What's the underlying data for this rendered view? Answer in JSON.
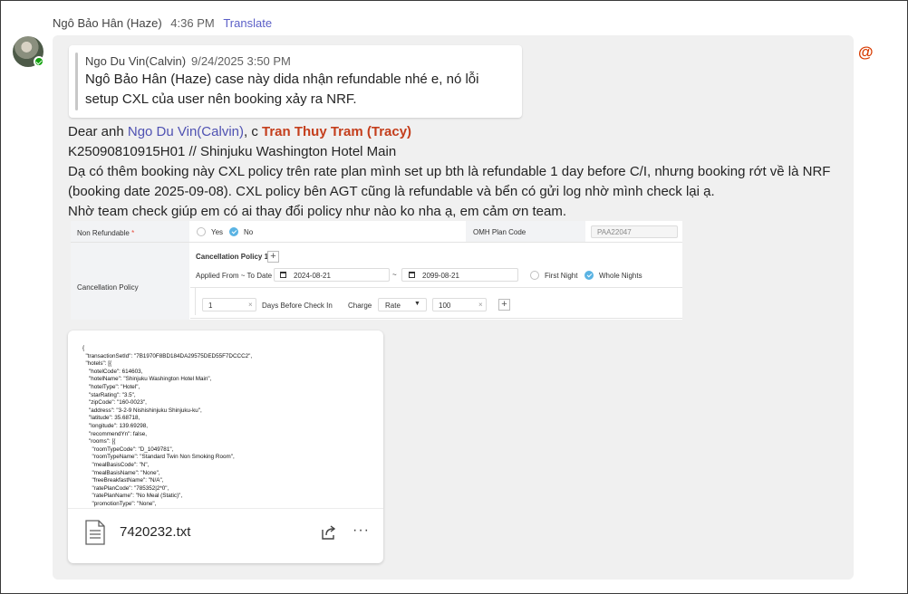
{
  "message": {
    "sender": "Ngô Bảo Hân (Haze)",
    "time": "4:36 PM",
    "translate": "Translate",
    "mention_symbol": "@"
  },
  "quote": {
    "author": "Ngo Du Vin(Calvin)",
    "time": "9/24/2025 3:50 PM",
    "text": "Ngô Bảo Hân (Haze) case này dida nhận refundable nhé e, nó lỗi setup CXL của user nên booking xảy ra NRF."
  },
  "body": {
    "greeting": "Dear anh ",
    "mention1": "Ngo Du Vin(Calvin)",
    "sep": ", c ",
    "mention2": "Tran Thuy Tram (Tracy)",
    "line2": "K25090810915H01 // Shinjuku Washington Hotel Main",
    "line3": "Dạ có thêm booking này CXL policy trên rate plan mình set up bth là refundable 1 day before C/I, nhưng booking rớt về là NRF (booking date 2025-09-08). CXL policy bên AGT cũng là refundable và bển có gửi log nhờ mình check lại ạ.",
    "line4": "Nhờ team check giúp em có ai thay đổi policy như nào ko nha ạ, em cảm ơn team."
  },
  "screenshot": {
    "non_refundable_label": "Non Refundable",
    "required_mark": "*",
    "yes": "Yes",
    "no": "No",
    "omh_label": "OMH Plan Code",
    "omh_value": "PAA22047",
    "cancellation_label": "Cancellation Policy",
    "policy_title": "Cancellation Policy 1",
    "applied_label": "Applied From ~ To Date",
    "date_from": "2024-08-21",
    "date_sep": "~",
    "date_to": "2099-08-21",
    "first_night": "First Night",
    "whole_nights": "Whole Nights",
    "days_value": "1",
    "days_label": "Days Before Check In",
    "charge_label": "Charge",
    "charge_type": "Rate",
    "charge_value": "100",
    "no_selected": true,
    "whole_nights_selected": true
  },
  "attachment": {
    "file_name": "7420232.txt",
    "preview": "{\n  \"transactionSetId\": \"7B1970F8BD184DA29575DED55F7DCCC2\",\n  \"hotels\": [{\n    \"hotelCode\": 614603,\n    \"hotelName\": \"Shinjuku Washington Hotel Main\",\n    \"hotelType\": \"Hotel\",\n    \"starRating\": \"3.5\",\n    \"zipCode\": \"160-0023\",\n    \"address\": \"3-2-9 Nishishinjuku Shinjuku-ku\",\n    \"latitude\": 35.68718,\n    \"longitude\": 139.69298,\n    \"recommendYn\": false,\n    \"rooms\": [{\n      \"roomTypeCode\": \"D_1049781\",\n      \"roomTypeName\": \"Standard Twin Non Smoking Room\",\n      \"mealBasisCode\": \"N\",\n      \"mealBasisName\": \"None\",\n      \"freeBreakfastName\": \"N/A\",\n      \"ratePlanCode\": \"785352|2*0\",\n      \"ratePlanName\": \"No Meal (Static)\",\n      \"promotionType\": \"None\",\n      \"promotionValue\": 0,"
  }
}
